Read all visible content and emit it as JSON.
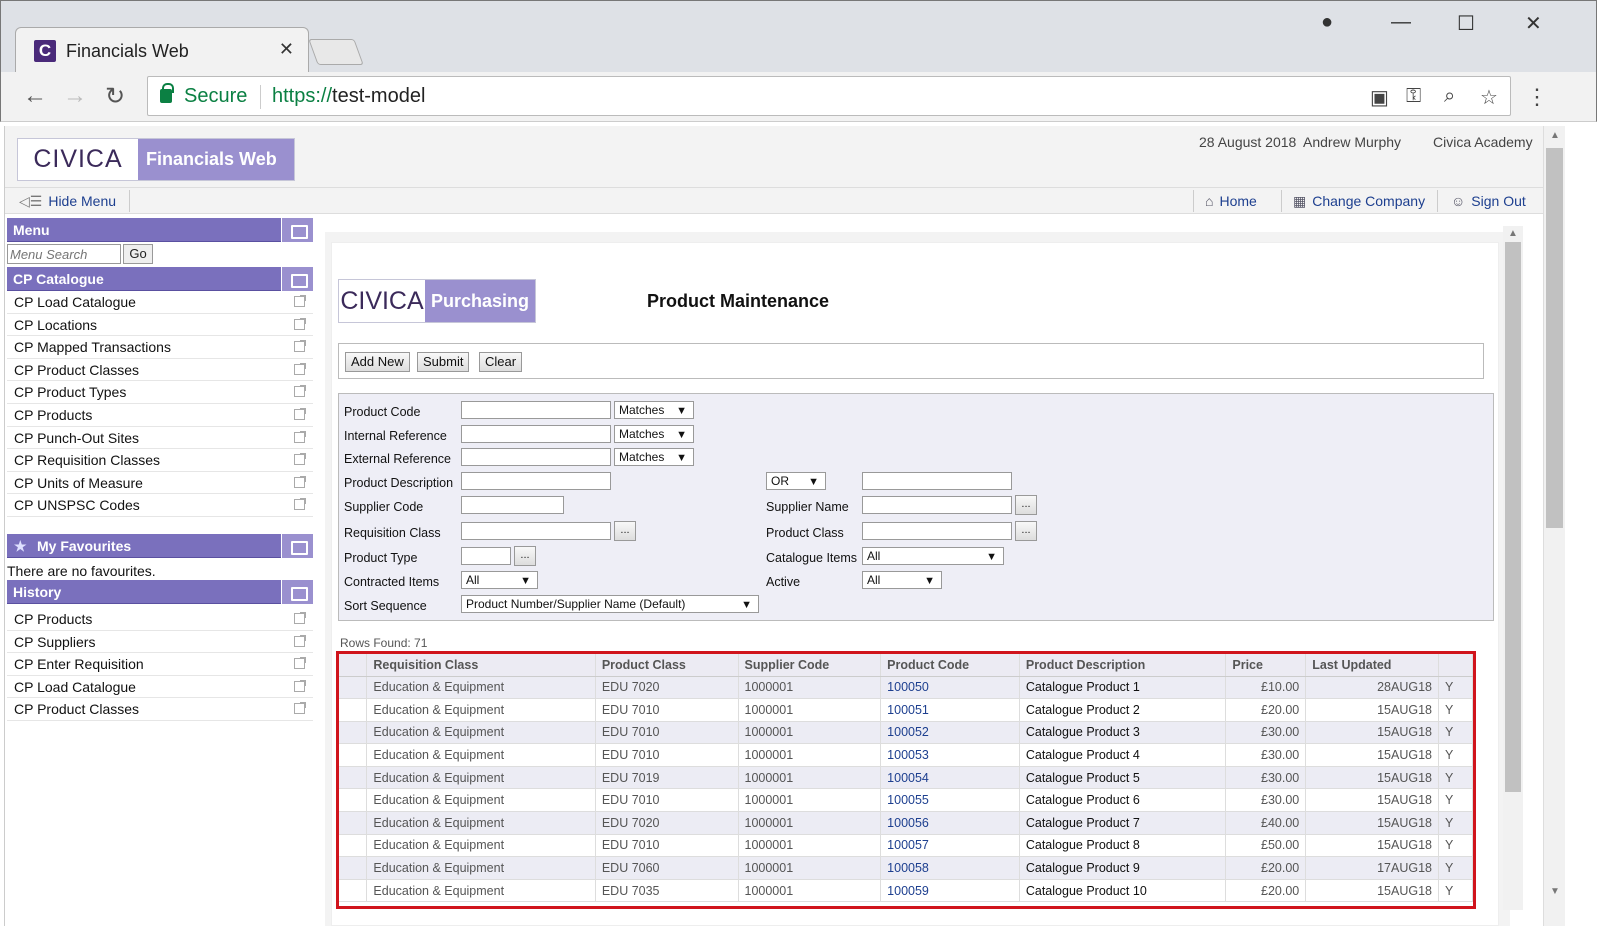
{
  "browser": {
    "tab_title": "Financials Web",
    "tab_favicon_letter": "C",
    "secure_label": "Secure",
    "url_scheme": "https://",
    "url_host": "test-model",
    "icons": [
      "back-icon",
      "forward-icon",
      "reload-icon",
      "popup-blocked-icon",
      "key-icon",
      "zoom-icon",
      "star-icon",
      "menu-icon",
      "profile-icon",
      "minimize-icon",
      "maximize-icon",
      "close-icon"
    ]
  },
  "header": {
    "logo_word": "CIVICA",
    "app_name": "Financials Web",
    "date": "28 August 2018",
    "user": "Andrew Murphy",
    "company": "Civica Academy"
  },
  "menubar": {
    "hide_menu": "Hide Menu",
    "home": "Home",
    "change_company": "Change Company",
    "sign_out": "Sign Out"
  },
  "sidebar": {
    "menu_title": "Menu",
    "search_placeholder": "Menu Search",
    "go_label": "Go",
    "catalogue_title": "CP Catalogue",
    "catalogue_items": [
      "CP Load Catalogue",
      "CP Locations",
      "CP Mapped Transactions",
      "CP Product Classes",
      "CP Product Types",
      "CP Products",
      "CP Punch-Out Sites",
      "CP Requisition Classes",
      "CP Units of Measure",
      "CP UNSPSC Codes"
    ],
    "favourites_title": "My Favourites",
    "no_favourites": "There are no favourites.",
    "history_title": "History",
    "history_items": [
      "CP Products",
      "CP Suppliers",
      "CP Enter Requisition",
      "CP Load Catalogue",
      "CP Product Classes"
    ]
  },
  "main": {
    "logo_word": "CIVICA",
    "module": "Purchasing",
    "title": "Product Maintenance",
    "actions": {
      "add_new": "Add New",
      "submit": "Submit",
      "clear": "Clear"
    },
    "filters": {
      "product_code": "Product Code",
      "internal_reference": "Internal Reference",
      "external_reference": "External Reference",
      "product_description": "Product  Description",
      "supplier_code": "Supplier Code",
      "requisition_class": "Requisition Class",
      "product_type": "Product Type",
      "contracted_items": "Contracted Items",
      "sort_sequence": "Sort Sequence",
      "supplier_name": "Supplier Name",
      "product_class": "Product Class",
      "catalogue_items": "Catalogue Items",
      "active": "Active",
      "matches": "Matches",
      "or": "OR",
      "all": "All",
      "sort_value": "Product Number/Supplier Name (Default)",
      "dots": "..."
    },
    "rows_found": "Rows Found: 71",
    "columns": [
      "",
      "Requisition Class",
      "Product Class",
      "Supplier Code",
      "Product Code",
      "Product Description",
      "Price",
      "Last Updated",
      ""
    ],
    "rows": [
      [
        "Education & Equipment",
        "EDU 7020",
        "1000001",
        "100050",
        "Catalogue Product 1",
        "£10.00",
        "28AUG18",
        "Y"
      ],
      [
        "Education & Equipment",
        "EDU 7010",
        "1000001",
        "100051",
        "Catalogue Product 2",
        "£20.00",
        "15AUG18",
        "Y"
      ],
      [
        "Education & Equipment",
        "EDU 7010",
        "1000001",
        "100052",
        "Catalogue Product 3",
        "£30.00",
        "15AUG18",
        "Y"
      ],
      [
        "Education & Equipment",
        "EDU 7010",
        "1000001",
        "100053",
        "Catalogue Product 4",
        "£30.00",
        "15AUG18",
        "Y"
      ],
      [
        "Education & Equipment",
        "EDU 7019",
        "1000001",
        "100054",
        "Catalogue Product 5",
        "£30.00",
        "15AUG18",
        "Y"
      ],
      [
        "Education & Equipment",
        "EDU 7010",
        "1000001",
        "100055",
        "Catalogue Product 6",
        "£30.00",
        "15AUG18",
        "Y"
      ],
      [
        "Education & Equipment",
        "EDU 7020",
        "1000001",
        "100056",
        "Catalogue Product 7",
        "£40.00",
        "15AUG18",
        "Y"
      ],
      [
        "Education & Equipment",
        "EDU 7010",
        "1000001",
        "100057",
        "Catalogue Product 8",
        "£50.00",
        "15AUG18",
        "Y"
      ],
      [
        "Education & Equipment",
        "EDU 7060",
        "1000001",
        "100058",
        "Catalogue Product 9",
        "£20.00",
        "17AUG18",
        "Y"
      ],
      [
        "Education & Equipment",
        "EDU 7035",
        "1000001",
        "100059",
        "Catalogue Product 10",
        "£20.00",
        "15AUG18",
        "Y"
      ]
    ]
  },
  "colors": {
    "accent": "#7a70bd",
    "accent_light": "#9a90cf",
    "highlight_border": "#d0141c",
    "link": "#1d3f8f"
  }
}
